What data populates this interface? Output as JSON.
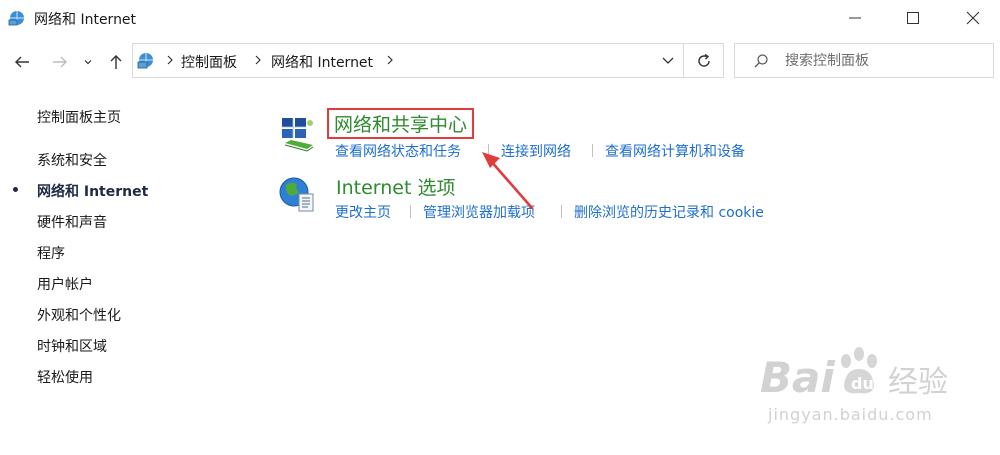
{
  "window": {
    "title": "网络和 Internet",
    "icon": "network-icon",
    "controls": [
      "minimize-icon",
      "maximize-icon",
      "close-icon"
    ]
  },
  "nav": {
    "back_icon": "arrow-left-icon",
    "forward_icon": "arrow-right-icon",
    "recent_icon": "chevron-down-icon",
    "up_icon": "arrow-up-icon",
    "breadcrumbs": [
      "控制面板",
      "网络和 Internet"
    ],
    "refresh_icon": "refresh-icon",
    "search_placeholder": "搜索控制面板"
  },
  "sidebar": {
    "home": "控制面板主页",
    "items": [
      {
        "label": "系统和安全",
        "active": false
      },
      {
        "label": "网络和 Internet",
        "active": true
      },
      {
        "label": "硬件和声音",
        "active": false
      },
      {
        "label": "程序",
        "active": false
      },
      {
        "label": "用户帐户",
        "active": false
      },
      {
        "label": "外观和个性化",
        "active": false
      },
      {
        "label": "时钟和区域",
        "active": false
      },
      {
        "label": "轻松使用",
        "active": false
      }
    ]
  },
  "categories": [
    {
      "title": "网络和共享中心",
      "icon": "network-sharing-icon",
      "highlighted": true,
      "links": [
        "查看网络状态和任务",
        "连接到网络",
        "查看网络计算机和设备"
      ]
    },
    {
      "title": "Internet 选项",
      "icon": "internet-globe-icon",
      "highlighted": false,
      "links": [
        "更改主页",
        "管理浏览器加载项",
        "删除浏览的历史记录和 cookie"
      ]
    }
  ],
  "colors": {
    "category_title": "#2e8b2e",
    "link": "#1e6fd0",
    "highlight_box": "#e03c3c",
    "arrow": "#e03c3c"
  },
  "watermark": {
    "brand": "Bai",
    "suffix": "经验",
    "url": "jingyan.baidu.com"
  }
}
